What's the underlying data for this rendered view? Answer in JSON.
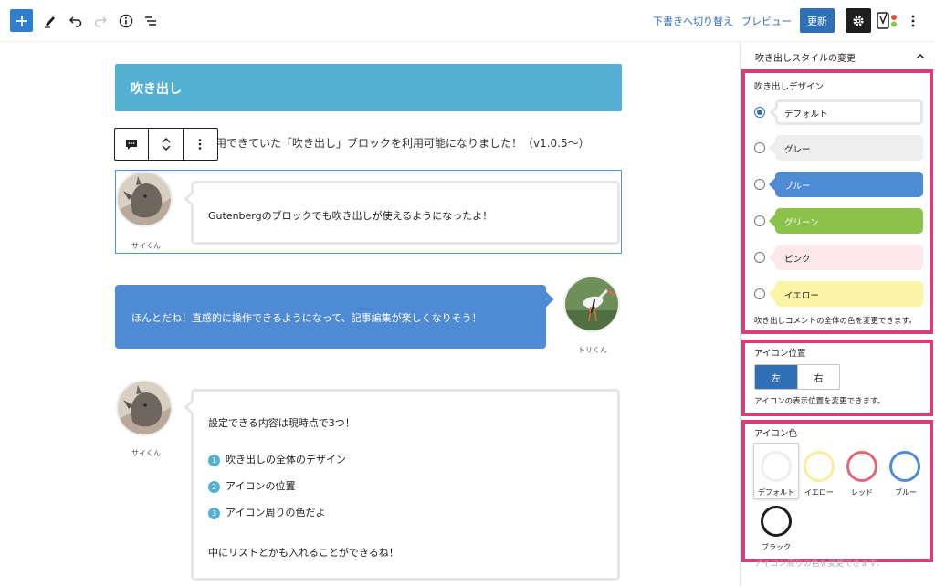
{
  "toolbar": {
    "switch_to_draft": "下書きへ切り替え",
    "preview": "プレビュー",
    "update": "更新"
  },
  "editor": {
    "heading": "吹き出し",
    "paragraph": "用できていた「吹き出し」ブロックを利用可能になりました！（v1.0.5〜）",
    "balloons": [
      {
        "name": "サイくん",
        "text": "Gutenbergのブロックでも吹き出しが使えるようになったよ！"
      },
      {
        "name": "トリくん",
        "text": "ほんとだね！直感的に操作できるようになって、記事編集が楽しくなりそう！"
      },
      {
        "name": "サイくん",
        "intro": "設定できる内容は現時点で3つ！",
        "list": [
          {
            "num": "1",
            "text": "吹き出しの全体のデザイン"
          },
          {
            "num": "2",
            "text": "アイコンの位置"
          },
          {
            "num": "3",
            "text": "アイコン周りの色だよ"
          }
        ],
        "outro": "中にリストとかも入れることができるね！"
      }
    ]
  },
  "sidebar": {
    "panel_title": "吹き出しスタイルの変更",
    "design": {
      "label": "吹き出しデザイン",
      "options": [
        {
          "label": "デフォルト",
          "selected": true,
          "bg": "#ffffff",
          "border": "#e6e6e6",
          "color": "#1e1e1e"
        },
        {
          "label": "グレー",
          "selected": false,
          "bg": "#eeeeee",
          "border": "#eeeeee",
          "color": "#1e1e1e"
        },
        {
          "label": "ブルー",
          "selected": false,
          "bg": "#4f8ad4",
          "border": "#4f8ad4",
          "color": "#ffffff"
        },
        {
          "label": "グリーン",
          "selected": false,
          "bg": "#8bc34a",
          "border": "#8bc34a",
          "color": "#ffffff"
        },
        {
          "label": "ピンク",
          "selected": false,
          "bg": "#fce8ea",
          "border": "#fce8ea",
          "color": "#1e1e1e"
        },
        {
          "label": "イエロー",
          "selected": false,
          "bg": "#fbf4a4",
          "border": "#fbf4a4",
          "color": "#1e1e1e"
        }
      ],
      "help": "吹き出しコメントの全体の色を変更できます。"
    },
    "position": {
      "label": "アイコン位置",
      "left": "左",
      "right": "右",
      "selected": "左",
      "help": "アイコンの表示位置を変更できます。"
    },
    "icon_color": {
      "label": "アイコン色",
      "swatches": [
        {
          "label": "デフォルト",
          "ring": "#eeeeee",
          "selected": true
        },
        {
          "label": "イエロー",
          "ring": "#f6ef9c",
          "selected": false
        },
        {
          "label": "レッド",
          "ring": "#e2677a",
          "selected": false
        },
        {
          "label": "ブルー",
          "ring": "#4f8ad4",
          "selected": false
        },
        {
          "label": "ブラック",
          "ring": "#1e1e1e",
          "selected": false
        }
      ],
      "help": "アイコン周りの色を変更できます。"
    }
  },
  "colors": {
    "accent": "#2f6fb5",
    "highlight": "#d63f7c",
    "heading_bg": "#54b0d4"
  }
}
